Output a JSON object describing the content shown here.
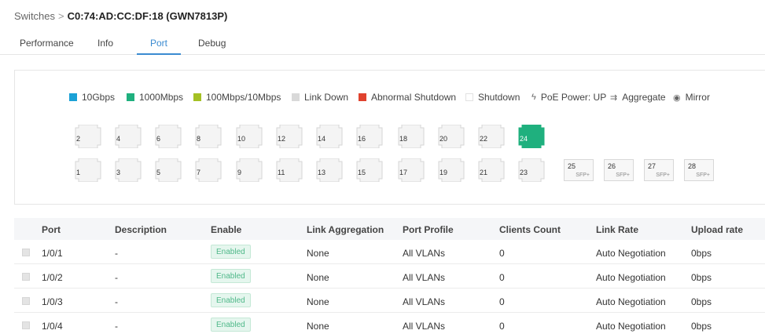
{
  "breadcrumb": {
    "parent": "Switches",
    "separator": ">",
    "current": "C0:74:AD:CC:DF:18 (GWN7813P)"
  },
  "tabs": [
    {
      "label": "Performance",
      "active": false
    },
    {
      "label": "Info",
      "active": false
    },
    {
      "label": "Port",
      "active": true
    },
    {
      "label": "Debug",
      "active": false
    }
  ],
  "legend": [
    {
      "label": "10Gbps",
      "color": "#1ba1d6",
      "kind": "swatch"
    },
    {
      "label": "1000Mbps",
      "color": "#1fb07e",
      "kind": "swatch"
    },
    {
      "label": "100Mbps/10Mbps",
      "color": "#a4c024",
      "kind": "swatch"
    },
    {
      "label": "Link Down",
      "color": "#d9d9d9",
      "kind": "swatch"
    },
    {
      "label": "Abnormal Shutdown",
      "color": "#e0422e",
      "kind": "swatch"
    },
    {
      "label": "Shutdown",
      "color": "#ffffff",
      "kind": "swatch"
    },
    {
      "label": "PoE Power: UP",
      "icon": "lightning-icon",
      "kind": "icon"
    },
    {
      "label": "Aggregate",
      "icon": "aggregate-icon",
      "kind": "icon"
    },
    {
      "label": "Mirror",
      "icon": "eye-icon",
      "kind": "icon"
    }
  ],
  "ports": {
    "top_row": [
      "2",
      "4",
      "6",
      "8",
      "10",
      "12",
      "14",
      "16",
      "18",
      "20",
      "22",
      "24"
    ],
    "bottom_row": [
      "1",
      "3",
      "5",
      "7",
      "9",
      "11",
      "13",
      "15",
      "17",
      "19",
      "21",
      "23"
    ],
    "up_ports": [
      "24"
    ],
    "up_color": "#1fb07e",
    "sfp": [
      {
        "num": "25",
        "tag": "SFP+"
      },
      {
        "num": "26",
        "tag": "SFP+"
      },
      {
        "num": "27",
        "tag": "SFP+"
      },
      {
        "num": "28",
        "tag": "SFP+"
      }
    ]
  },
  "table": {
    "headers": [
      "Port",
      "Description",
      "Enable",
      "Link Aggregation",
      "Port Profile",
      "Clients Count",
      "Link Rate",
      "Upload rate"
    ],
    "rows": [
      {
        "port": "1/0/1",
        "description": "-",
        "enable": "Enabled",
        "link_aggregation": "None",
        "port_profile": "All VLANs",
        "clients_count": "0",
        "link_rate": "Auto Negotiation",
        "upload_rate": "0bps"
      },
      {
        "port": "1/0/2",
        "description": "-",
        "enable": "Enabled",
        "link_aggregation": "None",
        "port_profile": "All VLANs",
        "clients_count": "0",
        "link_rate": "Auto Negotiation",
        "upload_rate": "0bps"
      },
      {
        "port": "1/0/3",
        "description": "-",
        "enable": "Enabled",
        "link_aggregation": "None",
        "port_profile": "All VLANs",
        "clients_count": "0",
        "link_rate": "Auto Negotiation",
        "upload_rate": "0bps"
      },
      {
        "port": "1/0/4",
        "description": "-",
        "enable": "Enabled",
        "link_aggregation": "None",
        "port_profile": "All VLANs",
        "clients_count": "0",
        "link_rate": "Auto Negotiation",
        "upload_rate": "0bps"
      }
    ]
  }
}
